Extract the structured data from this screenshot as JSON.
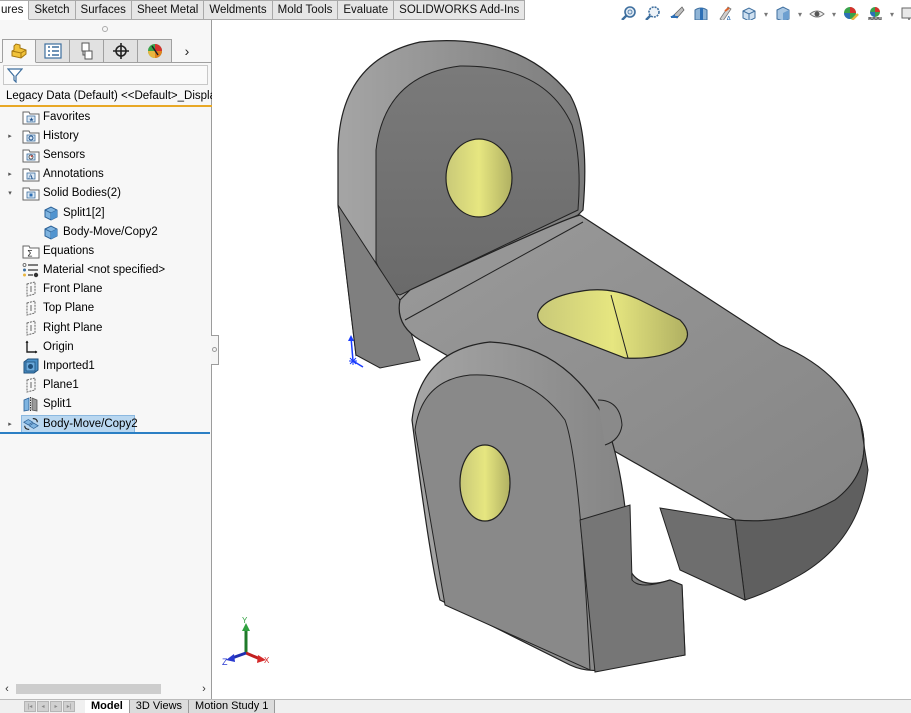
{
  "command_manager": {
    "tabs": [
      {
        "label": "ures",
        "active": true
      },
      {
        "label": "Sketch",
        "active": false
      },
      {
        "label": "Surfaces",
        "active": false
      },
      {
        "label": "Sheet Metal",
        "active": false
      },
      {
        "label": "Weldments",
        "active": false
      },
      {
        "label": "Mold Tools",
        "active": false
      },
      {
        "label": "Evaluate",
        "active": false
      },
      {
        "label": "SOLIDWORKS Add-Ins",
        "active": false
      }
    ]
  },
  "heads_up_toolbar": {
    "icons": [
      "zoom-to-fit-icon",
      "zoom-to-area-icon",
      "previous-view-icon",
      "section-view-icon",
      "dynamic-annotation-views-icon",
      "view-orientation-icon",
      "display-style-icon",
      "hide-show-items-icon",
      "edit-appearance-icon",
      "apply-scene-icon",
      "view-settings-icon"
    ]
  },
  "feature_manager": {
    "tabs": [
      {
        "name": "feature-tree",
        "active": true
      },
      {
        "name": "property-manager",
        "active": false
      },
      {
        "name": "configuration-manager",
        "active": false
      },
      {
        "name": "dimxpert-manager",
        "active": false
      },
      {
        "name": "display-manager",
        "active": false
      }
    ],
    "more_label": "›",
    "root_label": "Legacy Data (Default) <<Default>_Displa",
    "items": [
      {
        "label": "Favorites",
        "icon": "favorites-folder-icon",
        "expander": "",
        "level": 0
      },
      {
        "label": "History",
        "icon": "history-folder-icon",
        "expander": "▸",
        "level": 0
      },
      {
        "label": "Sensors",
        "icon": "sensors-folder-icon",
        "expander": "",
        "level": 0
      },
      {
        "label": "Annotations",
        "icon": "annotations-folder-icon",
        "expander": "▸",
        "level": 0
      },
      {
        "label": "Solid Bodies(2)",
        "icon": "solid-bodies-folder-icon",
        "expander": "▾",
        "level": 0
      },
      {
        "label": "Split1[2]",
        "icon": "solid-body-icon",
        "expander": "",
        "level": 1
      },
      {
        "label": "Body-Move/Copy2",
        "icon": "solid-body-icon",
        "expander": "",
        "level": 1
      },
      {
        "label": "Equations",
        "icon": "equations-folder-icon",
        "expander": "",
        "level": 0
      },
      {
        "label": "Material <not specified>",
        "icon": "material-icon",
        "expander": "",
        "level": 0
      },
      {
        "label": "Front Plane",
        "icon": "plane-icon",
        "expander": "",
        "level": 0
      },
      {
        "label": "Top Plane",
        "icon": "plane-icon",
        "expander": "",
        "level": 0
      },
      {
        "label": "Right Plane",
        "icon": "plane-icon",
        "expander": "",
        "level": 0
      },
      {
        "label": "Origin",
        "icon": "origin-icon",
        "expander": "",
        "level": 0
      },
      {
        "label": "Imported1",
        "icon": "imported-feature-icon",
        "expander": "",
        "level": 0
      },
      {
        "label": "Plane1",
        "icon": "plane-icon",
        "expander": "",
        "level": 0
      },
      {
        "label": "Split1",
        "icon": "split-feature-icon",
        "expander": "",
        "level": 0
      },
      {
        "label": "Body-Move/Copy2",
        "icon": "move-copy-body-icon",
        "expander": "▸",
        "level": 0,
        "selected": true
      }
    ],
    "scroll_left": "‹",
    "scroll_right": "›"
  },
  "bottom_tabs": [
    {
      "label": "Model",
      "active": true
    },
    {
      "label": "3D Views",
      "active": false
    },
    {
      "label": "Motion Study 1",
      "active": false
    }
  ],
  "triad": {
    "x_label": "X",
    "y_label": "Y",
    "z_label": "Z"
  },
  "colors": {
    "model_face": "#8c8c8c",
    "hole_face": "#d8d878",
    "selection": "#b9d7f0",
    "rollback_bar": "#2b7fc4",
    "root_underline": "#e8a826"
  }
}
